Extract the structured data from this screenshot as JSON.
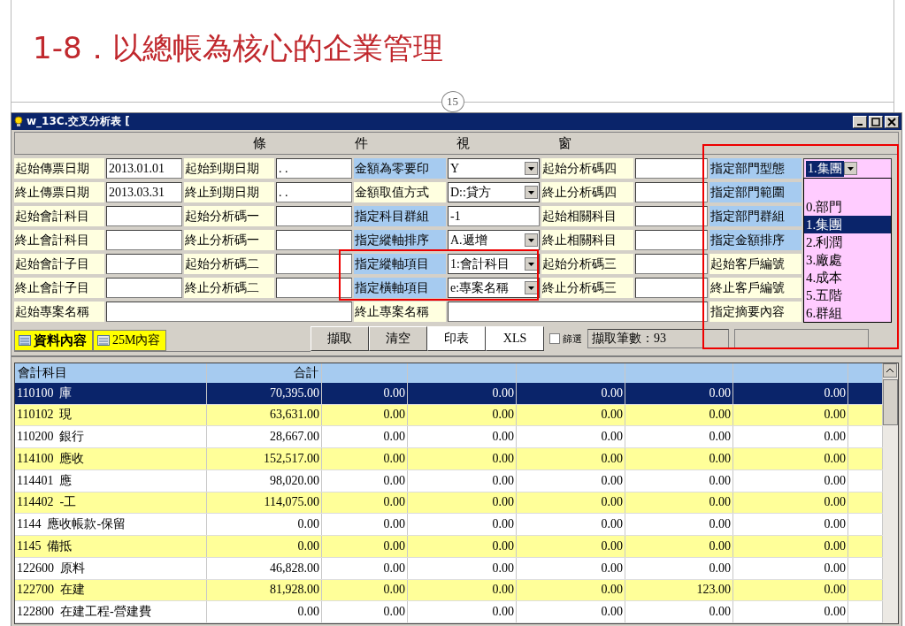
{
  "slide": {
    "title": "1-8．以總帳為核心的企業管理",
    "page_number": "15"
  },
  "window": {
    "title": "w_13C.交叉分析表 ["
  },
  "condition_bar": [
    "條",
    "件",
    "視",
    "窗"
  ],
  "form": {
    "rows": [
      [
        {
          "label": "起始傳票日期",
          "emphasized": false,
          "kind": "date",
          "value": "2013.01.01"
        },
        {
          "label": "起始到期日期",
          "emphasized": false,
          "kind": "date",
          "value": ". ."
        },
        {
          "label": "金額為零要印",
          "emphasized": true,
          "kind": "combo",
          "value": "Y"
        },
        {
          "label": "起始分析碼四",
          "emphasized": false,
          "kind": "text"
        },
        {
          "label": "指定部門型態",
          "emphasized": true,
          "kind": "combo",
          "value": "1.集團"
        }
      ],
      [
        {
          "label": "終止傳票日期",
          "emphasized": false,
          "kind": "date",
          "value": "2013.03.31"
        },
        {
          "label": "終止到期日期",
          "emphasized": false,
          "kind": "date",
          "value": ". ."
        },
        {
          "label": "金額取值方式",
          "emphasized": false,
          "kind": "combo",
          "value": "D::貸方"
        },
        {
          "label": "終止分析碼四",
          "emphasized": false,
          "kind": "text"
        },
        {
          "label": "指定部門範圍",
          "emphasized": true,
          "kind": "covered"
        }
      ],
      [
        {
          "label": "起始會計科目",
          "emphasized": false,
          "kind": "text"
        },
        {
          "label": "起始分析碼一",
          "emphasized": false,
          "kind": "text"
        },
        {
          "label": "指定科目群組",
          "emphasized": true,
          "kind": "text",
          "value": "-1"
        },
        {
          "label": "起始相關科目",
          "emphasized": false,
          "kind": "text"
        },
        {
          "label": "指定部門群組",
          "emphasized": true,
          "kind": "covered"
        }
      ],
      [
        {
          "label": "終止會計科目",
          "emphasized": false,
          "kind": "text"
        },
        {
          "label": "終止分析碼一",
          "emphasized": false,
          "kind": "text"
        },
        {
          "label": "指定縱軸排序",
          "emphasized": true,
          "kind": "combo",
          "value": "A.遞增"
        },
        {
          "label": "終止相關科目",
          "emphasized": false,
          "kind": "text"
        },
        {
          "label": "指定金額排序",
          "emphasized": true,
          "kind": "covered"
        }
      ],
      [
        {
          "label": "起始會計子目",
          "emphasized": false,
          "kind": "text"
        },
        {
          "label": "起始分析碼二",
          "emphasized": false,
          "kind": "text"
        },
        {
          "label": "指定縱軸項目",
          "emphasized": true,
          "kind": "combo",
          "value": "1:會計科目"
        },
        {
          "label": "起始分析碼三",
          "emphasized": false,
          "kind": "text"
        },
        {
          "label": "起始客戶編號",
          "emphasized": false,
          "kind": "covered"
        }
      ],
      [
        {
          "label": "終止會計子目",
          "emphasized": false,
          "kind": "text"
        },
        {
          "label": "終止分析碼二",
          "emphasized": false,
          "kind": "text"
        },
        {
          "label": "指定橫軸項目",
          "emphasized": true,
          "kind": "combo",
          "value": "e:專案名稱"
        },
        {
          "label": "終止分析碼三",
          "emphasized": false,
          "kind": "text"
        },
        {
          "label": "終止客戶編號",
          "emphasized": false,
          "kind": "covered"
        }
      ]
    ],
    "project_row": [
      {
        "label": "起始專案名稱",
        "emphasized": false,
        "kind": "wide"
      },
      {
        "label": "終止專案名稱",
        "emphasized": false,
        "kind": "wide"
      },
      {
        "label": "指定摘要內容",
        "emphasized": false,
        "kind": "covered"
      }
    ]
  },
  "dropdown": {
    "items": [
      {
        "label": "0.部門",
        "selected": false
      },
      {
        "label": "1.集團",
        "selected": true
      },
      {
        "label": "2.利潤",
        "selected": false
      },
      {
        "label": "3.廠處",
        "selected": false
      },
      {
        "label": "4.成本",
        "selected": false
      },
      {
        "label": "5.五階",
        "selected": false
      },
      {
        "label": "6.群組",
        "selected": false
      }
    ]
  },
  "tabs": [
    {
      "label": "資料內容",
      "selected": true
    },
    {
      "label": "25M內容",
      "selected": false
    }
  ],
  "buttons": [
    "擷取",
    "清空",
    "印表",
    "XLS"
  ],
  "filter": {
    "label": "篩選",
    "checked": false
  },
  "record_count": "擷取筆數：93",
  "table": {
    "columns": [
      "會計科目",
      "合計"
    ],
    "rows": [
      {
        "code": "110100",
        "name": "庫",
        "values": [
          "70,395.00",
          "0.00",
          "0.00",
          "0.00",
          "0.00",
          "0.00"
        ],
        "selected": true
      },
      {
        "code": "110102",
        "name": "現",
        "values": [
          "63,631.00",
          "0.00",
          "0.00",
          "0.00",
          "0.00",
          "0.00"
        ],
        "selected": false
      },
      {
        "code": "110200",
        "name": "銀行",
        "values": [
          "28,667.00",
          "0.00",
          "0.00",
          "0.00",
          "0.00",
          "0.00"
        ],
        "selected": false
      },
      {
        "code": "114100",
        "name": "應收",
        "values": [
          "152,517.00",
          "0.00",
          "0.00",
          "0.00",
          "0.00",
          "0.00"
        ],
        "selected": false
      },
      {
        "code": "114401",
        "name": "應",
        "values": [
          "98,020.00",
          "0.00",
          "0.00",
          "0.00",
          "0.00",
          "0.00"
        ],
        "selected": false
      },
      {
        "code": "114402",
        "name": "-工",
        "values": [
          "114,075.00",
          "0.00",
          "0.00",
          "0.00",
          "0.00",
          "0.00"
        ],
        "selected": false
      },
      {
        "code": "1144",
        "name": "應收帳款-保留",
        "values": [
          "0.00",
          "0.00",
          "0.00",
          "0.00",
          "0.00",
          "0.00"
        ],
        "selected": false
      },
      {
        "code": "1145",
        "name": "備抵",
        "values": [
          "0.00",
          "0.00",
          "0.00",
          "0.00",
          "0.00",
          "0.00"
        ],
        "selected": false
      },
      {
        "code": "122600",
        "name": "原料",
        "values": [
          "46,828.00",
          "0.00",
          "0.00",
          "0.00",
          "0.00",
          "0.00"
        ],
        "selected": false
      },
      {
        "code": "122700",
        "name": "在建",
        "values": [
          "81,928.00",
          "0.00",
          "0.00",
          "0.00",
          "123.00",
          "0.00"
        ],
        "selected": false
      },
      {
        "code": "122800",
        "name": "在建工程-營建費",
        "values": [
          "0.00",
          "0.00",
          "0.00",
          "0.00",
          "0.00",
          "0.00"
        ],
        "selected": false
      }
    ]
  }
}
